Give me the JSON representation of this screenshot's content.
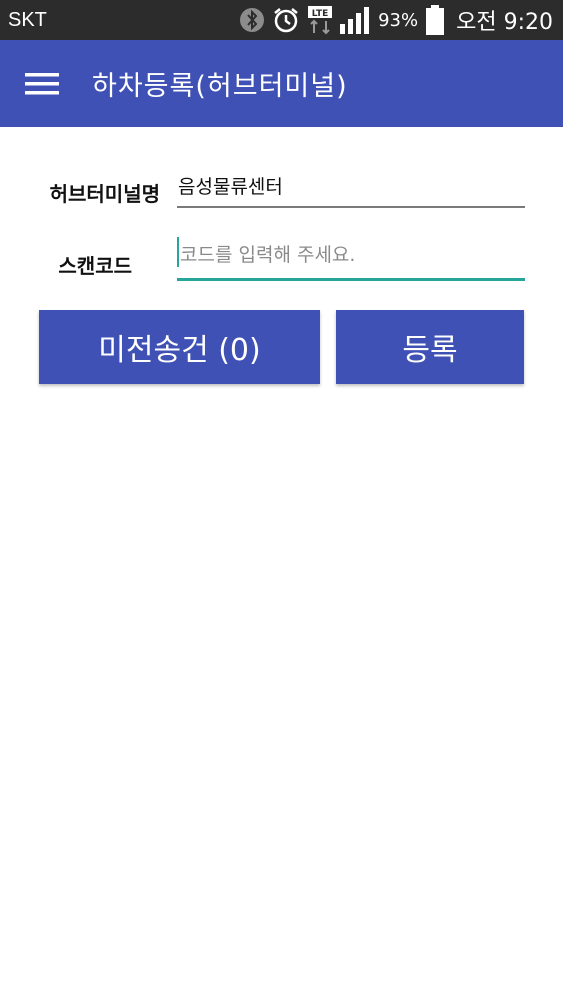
{
  "status_bar": {
    "carrier": "SKT",
    "network": "LTE",
    "battery": "93%",
    "time": "오전 9:20",
    "icons": [
      "bluetooth-icon",
      "alarm-icon",
      "lte-icon",
      "signal-icon",
      "battery-icon"
    ]
  },
  "app_bar": {
    "title": "하차등록(허브터미널)",
    "menu_icon": "hamburger-menu-icon",
    "color": "#3f51b5"
  },
  "form": {
    "terminal_label": "허브터미널명",
    "terminal_value": "음성물류센터",
    "scan_label": "스캔코드",
    "scan_value": "",
    "scan_placeholder": "코드를 입력해 주세요.",
    "accent_color": "#26a69a"
  },
  "buttons": {
    "unsent_label": "미전송건 (0)",
    "register_label": "등록"
  }
}
